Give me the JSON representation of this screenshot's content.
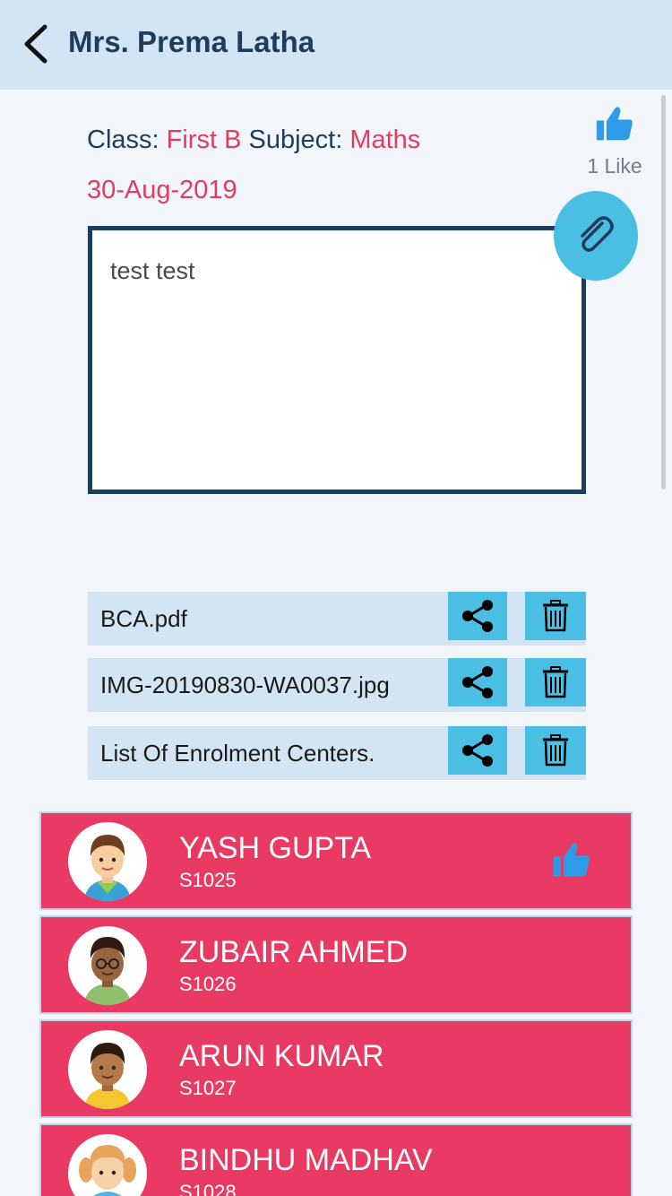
{
  "header": {
    "title": "Mrs. Prema Latha",
    "back_icon": "chevron-left-icon"
  },
  "meta": {
    "class_label": "Class: ",
    "class_value": "First B",
    "subject_label": " Subject: ",
    "subject_value": "Maths",
    "date": "30-Aug-2019"
  },
  "likes": {
    "count_label": "1 Like",
    "icon": "thumbs-up-icon"
  },
  "note": {
    "text": "test test"
  },
  "attach": {
    "icon": "paperclip-icon"
  },
  "files": [
    {
      "name": "BCA.pdf"
    },
    {
      "name": "IMG-20190830-WA0037.jpg"
    },
    {
      "name": "List Of Enrolment Centers."
    }
  ],
  "students": [
    {
      "name": "YASH GUPTA",
      "id": "S1025",
      "liked": true
    },
    {
      "name": "ZUBAIR AHMED",
      "id": "S1026",
      "liked": false
    },
    {
      "name": "ARUN KUMAR",
      "id": "S1027",
      "liked": false
    },
    {
      "name": "BINDHU MADHAV",
      "id": "S1028",
      "liked": false
    }
  ],
  "colors": {
    "accent_red": "#e13c62",
    "row_red": "#e83a62",
    "cyan": "#4bbfe3",
    "navy": "#1e3d5c",
    "like_blue": "#2d9ce8"
  }
}
